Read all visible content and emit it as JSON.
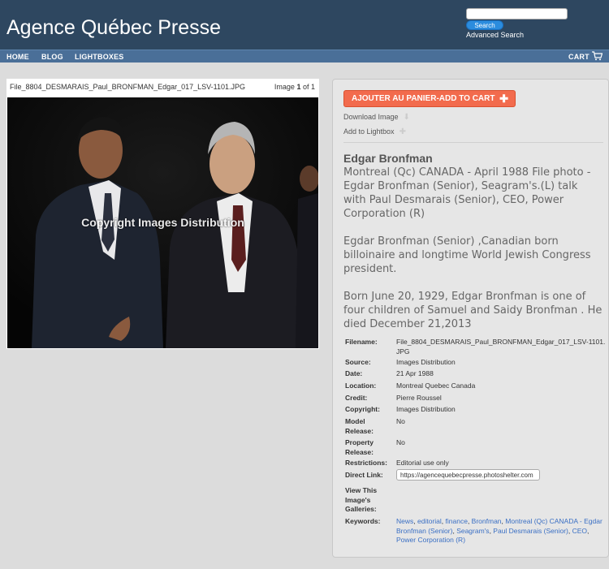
{
  "header": {
    "title": "Agence Québec Presse",
    "search_placeholder": "",
    "search_button": "Search",
    "advanced_search": "Advanced Search"
  },
  "nav": {
    "items": [
      "HOME",
      "BLOG",
      "LIGHTBOXES"
    ],
    "cart": "CART"
  },
  "image": {
    "filename": "File_8804_DESMARAIS_Paul_BRONFMAN_Edgar_017_LSV-1101.JPG",
    "counter_prefix": "Image",
    "counter_current": "1",
    "counter_suffix": "of 1",
    "watermark": "Copyright Images Distribution"
  },
  "actions": {
    "add_to_cart": "AJOUTER AU PANIER-ADD TO CART",
    "download": "Download Image",
    "lightbox": "Add to Lightbox"
  },
  "details": {
    "headline": "Edgar Bronfman",
    "caption": "Montreal (Qc) CANADA - April 1988 File photo - Egdar Bronfman (Senior), Seagram's.(L) talk with Paul Desmarais (Senior), CEO, Power Corporation (R)\n\nEgdar Bronfman (Senior) ,Canadian born billoinaire and longtime World Jewish Congress president.\n\nBorn June 20, 1929, Edgar Bronfman is one of four children of Samuel and Saidy Bronfman . He died December 21,2013"
  },
  "meta": {
    "filename_label": "Filename:",
    "filename_value": "File_8804_DESMARAIS_Paul_BRONFMAN_Edgar_017_LSV-1101.JPG",
    "source_label": "Source:",
    "source_value": "Images Distribution",
    "date_label": "Date:",
    "date_value": "21 Apr 1988",
    "location_label": "Location:",
    "location_value": "Montreal Quebec Canada",
    "credit_label": "Credit:",
    "credit_value": "Pierre Roussel",
    "copyright_label": "Copyright:",
    "copyright_value": "Images Distribution",
    "model_label": "Model Release:",
    "model_value": "No",
    "property_label": "Property Release:",
    "property_value": "No",
    "restrictions_label": "Restrictions:",
    "restrictions_value": "Editorial use only",
    "direct_label": "Direct Link:",
    "direct_value": "https://agencequebecpresse.photoshelter.com",
    "galleries_label": "View This Image's Galleries:",
    "keywords_label": "Keywords:",
    "keywords": [
      "News",
      "editorial",
      "finance",
      "Bronfman",
      "Montreal (Qc) CANADA - Egdar Bronfman (Senior)",
      "Seagram's",
      "Paul Desmarais (Senior)",
      "CEO",
      "Power Corporation (R)"
    ]
  },
  "colors": {
    "header_bg": "#2e4760",
    "nav_bg": "#4a6f98",
    "cart_button": "#f26b4d",
    "link": "#3a6fc4"
  }
}
